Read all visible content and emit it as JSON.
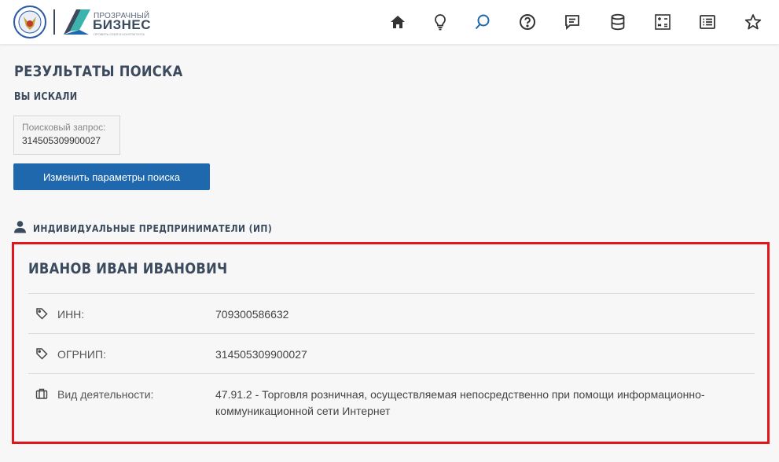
{
  "header": {
    "logo_line1": "ПРОЗРАЧНЫЙ",
    "logo_line2": "БИЗНЕС",
    "logo_tagline": "ПРОВЕРЬ СЕБЯ И КОНТРАГЕНТА",
    "nav_icons": [
      "home-icon",
      "lightbulb-icon",
      "search-icon",
      "help-icon",
      "chat-icon",
      "database-icon",
      "calculator-icon",
      "list-icon",
      "star-icon"
    ],
    "active_color": "#1f68ad"
  },
  "main": {
    "title": "РЕЗУЛЬТАТЫ ПОИСКА",
    "subtitle": "ВЫ ИСКАЛИ",
    "query": {
      "label": "Поисковый запрос:",
      "value": "314505309900027"
    },
    "change_button": "Изменить параметры поиска",
    "section_title": "ИНДИВИДУАЛЬНЫЕ ПРЕДПРИНИМАТЕЛИ (ИП)"
  },
  "result": {
    "name": "ИВАНОВ ИВАН ИВАНОВИЧ",
    "inn_label": "ИНН:",
    "inn_value": "709300586632",
    "ogrnip_label": "ОГРНИП:",
    "ogrnip_value": "314505309900027",
    "activity_label": "Вид деятельности:",
    "activity_value": "47.91.2 - Торговля розничная, осуществляемая непосредственно при помощи информационно-коммуникационной сети Интернет"
  },
  "colors": {
    "primary": "#1f68ad",
    "heading": "#3c4a5e",
    "highlight_border": "#e3141c"
  }
}
